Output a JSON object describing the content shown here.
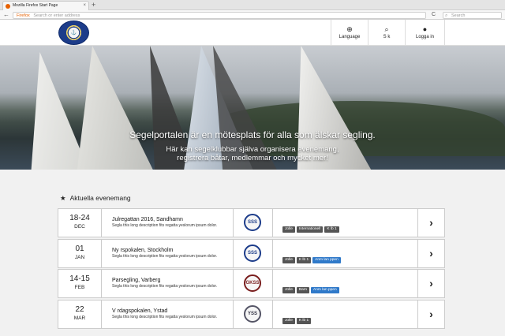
{
  "browser": {
    "tab_title": "Mozilla Firefox Start Page",
    "tab_close": "×",
    "new_tab": "+",
    "back": "←",
    "url_brand": "Firefox",
    "url_placeholder": "Search or enter address",
    "reload": "C",
    "search_placeholder": "Search",
    "search_icon": "⌕"
  },
  "header": {
    "nav": [
      {
        "label": "Language",
        "icon": "⊕",
        "icon_name": "globe-icon"
      },
      {
        "label": "S  k",
        "icon": "⌕",
        "icon_name": "search-icon"
      },
      {
        "label": "Logga in",
        "icon": "●",
        "icon_name": "user-icon"
      }
    ]
  },
  "hero": {
    "title": "Segelportalen är en mötesplats för alla som älskar segling.",
    "subtitle_1": "Här kan segelklubbar själva organisera evenemang,",
    "subtitle_2": "registrera båtar, medlemmar och mycket mer!"
  },
  "events": {
    "heading": "Aktuella evenemang",
    "star": "★",
    "arrow": "›",
    "items": [
      {
        "day": "18-24",
        "month": "DEC",
        "title": "Julregattan 2016, Sandhamn",
        "desc": "Segla this long description fits regatta yeslorum ipsum dolor.",
        "club": "SSS",
        "tags": [
          "Jolle",
          "Internationell",
          "K  lb 1"
        ],
        "tag_blue": [
          false,
          false,
          false
        ]
      },
      {
        "day": "01",
        "month": "JAN",
        "title": "Ny   rspokalen, Stockholm",
        "desc": "Segla this long description fits regatta yeslorum ipsum dolor.",
        "club": "SSS",
        "tags": [
          "Jolle",
          "K  lb 1",
          "Anm  lan  ppen"
        ],
        "tag_blue": [
          false,
          false,
          true
        ]
      },
      {
        "day": "14-15",
        "month": "FEB",
        "title": "Parsegling, Varberg",
        "desc": "Segla this long description fits regatta yeslorum ipsum dolor.",
        "club": "GKSS",
        "tags": [
          "Jolle",
          "Barn",
          "Anm  lan  ppen"
        ],
        "tag_blue": [
          false,
          false,
          true
        ]
      },
      {
        "day": "22",
        "month": "MAR",
        "title": "V  rdagspokalen, Ystad",
        "desc": "Segla this long description fits regatta yeslorum ipsum dolor.",
        "club": "YSS",
        "tags": [
          "Jolle",
          "K  lb 1"
        ],
        "tag_blue": [
          false,
          false
        ]
      }
    ]
  }
}
